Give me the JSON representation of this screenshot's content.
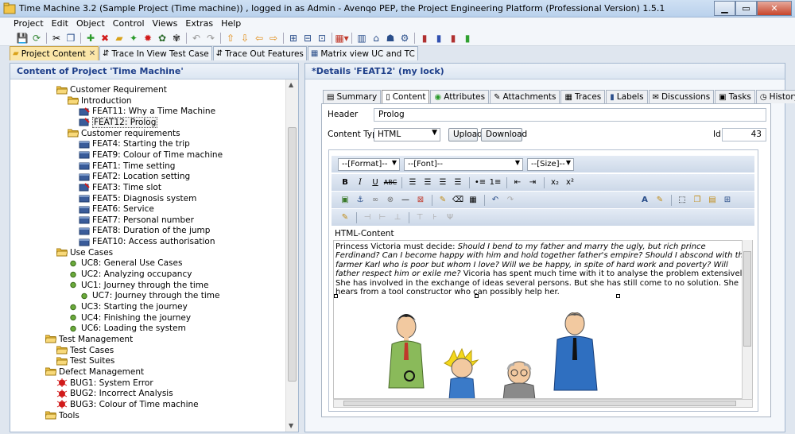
{
  "window": {
    "title": "Time Machine 3.2 (Sample Project (Time machine)) , logged in as Admin - Avenqo PEP, the Project Engineering Platform (Professional Version) 1.5.1"
  },
  "menu": [
    "Project",
    "Edit",
    "Object",
    "Control",
    "Views",
    "Extras",
    "Help"
  ],
  "tabs": [
    {
      "label": "Project Content",
      "active": true
    },
    {
      "label": "Trace In View Test Case"
    },
    {
      "label": "Trace Out Features"
    },
    {
      "label": "Matrix view UC and TC"
    }
  ],
  "left_panel": {
    "title": "Content of Project 'Time Machine'",
    "tree": [
      {
        "label": "Customer Requirement",
        "icon": "folder-open-icon",
        "level": 0
      },
      {
        "label": "Introduction",
        "icon": "folder-open-icon",
        "level": 1
      },
      {
        "label": "FEAT11: Why a Time Machine",
        "icon": "feature-edit-icon",
        "level": 2
      },
      {
        "label": "FEAT12: Prolog",
        "icon": "feature-edit-icon",
        "level": 2,
        "selected": true
      },
      {
        "label": "Customer requirements",
        "icon": "folder-open-icon",
        "level": 1
      },
      {
        "label": "FEAT4: Starting the trip",
        "icon": "feature-icon",
        "level": 2
      },
      {
        "label": "FEAT9: Colour of Time machine",
        "icon": "feature-icon",
        "level": 2
      },
      {
        "label": "FEAT1: Time setting",
        "icon": "feature-icon",
        "level": 2
      },
      {
        "label": "FEAT2: Location setting",
        "icon": "feature-icon",
        "level": 2
      },
      {
        "label": "FEAT3: Time slot",
        "icon": "feature-edit-icon",
        "level": 2
      },
      {
        "label": "FEAT5: Diagnosis system",
        "icon": "feature-icon",
        "level": 2
      },
      {
        "label": "FEAT6: Service",
        "icon": "feature-icon",
        "level": 2
      },
      {
        "label": "FEAT7: Personal number",
        "icon": "feature-icon",
        "level": 2
      },
      {
        "label": "FEAT8: Duration of the jump",
        "icon": "feature-icon",
        "level": 2
      },
      {
        "label": "FEAT10: Access authorisation",
        "icon": "feature-icon",
        "level": 2
      },
      {
        "label": "Use Cases",
        "icon": "folder-open-icon",
        "level": 0
      },
      {
        "label": "UC8: General Use Cases",
        "icon": "usecase-dot-icon",
        "level": 1
      },
      {
        "label": "UC2: Analyzing occupancy",
        "icon": "usecase-dot-icon",
        "level": 1
      },
      {
        "label": "UC1: Journey through the time",
        "icon": "usecase-dot-icon",
        "level": 1
      },
      {
        "label": "UC7: Journey through the time",
        "icon": "usecase-dot-icon",
        "level": 2
      },
      {
        "label": "UC3: Starting the journey",
        "icon": "usecase-dot-icon",
        "level": 1
      },
      {
        "label": "UC4: Finishing the journey",
        "icon": "usecase-dot-icon",
        "level": 1
      },
      {
        "label": "UC6: Loading the system",
        "icon": "usecase-dot-icon",
        "level": 1
      },
      {
        "label": "Test Management",
        "icon": "folder-open-icon",
        "level": -1
      },
      {
        "label": "Test Cases",
        "icon": "folder-open-icon",
        "level": 0
      },
      {
        "label": "Test Suites",
        "icon": "folder-open-icon",
        "level": 0
      },
      {
        "label": "Defect Management",
        "icon": "folder-open-icon",
        "level": -1
      },
      {
        "label": "BUG1: System Error",
        "icon": "bug-icon",
        "level": 0
      },
      {
        "label": "BUG2: Incorrect Analysis",
        "icon": "bug-icon",
        "level": 0
      },
      {
        "label": "BUG3: Colour of Time machine",
        "icon": "bug-icon",
        "level": 0
      },
      {
        "label": "Tools",
        "icon": "folder-open-icon",
        "level": -1
      }
    ]
  },
  "right_panel": {
    "title": "*Details 'FEAT12' (my lock)",
    "tabs": [
      "Summary",
      "Content",
      "Attributes",
      "Attachments",
      "Traces",
      "Labels",
      "Discussions",
      "Tasks",
      "History"
    ],
    "active_tab": "Content",
    "header_label": "Header",
    "header_value": "Prolog",
    "content_type_label": "Content Type",
    "content_type_value": "HTML",
    "upload_label": "Upload",
    "download_label": "Download",
    "id_label": "Id",
    "id_value": "43",
    "editor": {
      "format_select": "--[Format]--",
      "font_select": "--[Font]--",
      "size_select": "--[Size]--",
      "html_content_label": "HTML-Content",
      "text_lead": "Princess Victoria must decide: ",
      "text_italic": "Should I bend to my father and marry the ugly, but rich prince Ferdinand? Can I become happy with him and hold together father's empire? Should I abscond with the farmer Karl who is poor but whom I love? Will we be happy, in spite of hard work and poverty? Will father respect him or exile me?",
      "text_tail": " Vicoria has spent much time with it to analyse the problem extensively. She has involved in the exchange of ideas several persons. But she has still come to no solution. She hears from a tool constructor who can possibly help her."
    }
  },
  "colors": {
    "accent": "#1e3f8a",
    "active_tab": "#fbe6a8",
    "bug": "#d11a1a",
    "usecase": "#5a9a2a"
  }
}
